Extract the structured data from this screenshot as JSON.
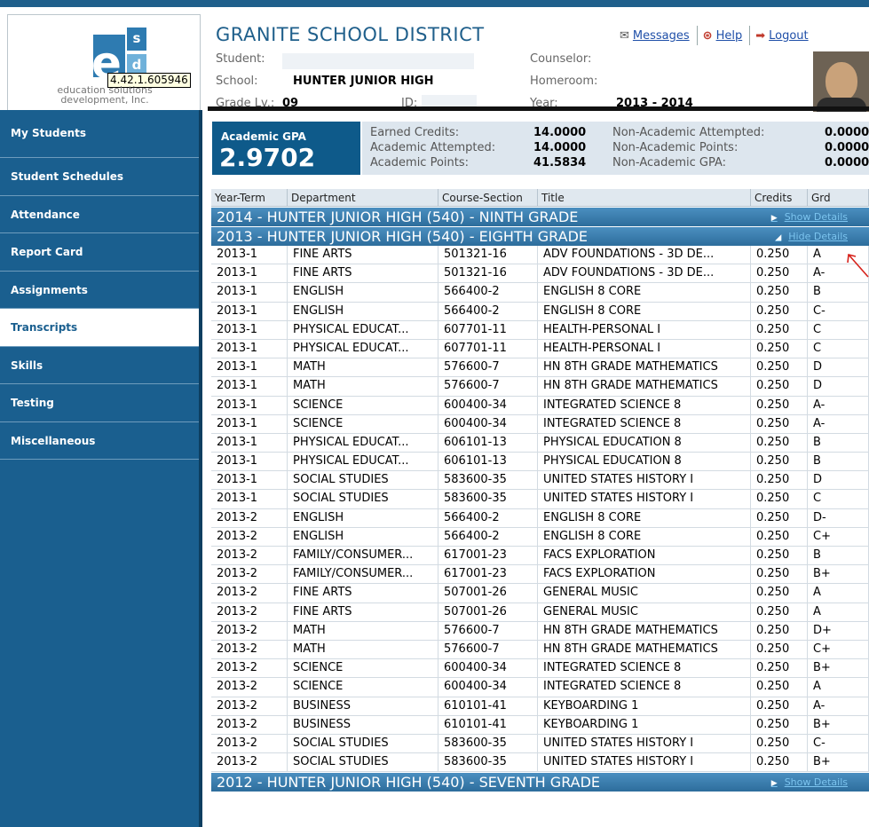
{
  "header": {
    "district": "GRANITE SCHOOL DISTRICT",
    "links": [
      {
        "label": "Messages",
        "icon": "envelope-icon"
      },
      {
        "label": "Help",
        "icon": "lifebuoy-icon"
      },
      {
        "label": "Logout",
        "icon": "logout-icon"
      }
    ],
    "logo_text_1": "education solutions",
    "logo_text_2": "development, Inc.",
    "logo_letters": {
      "e": "e",
      "s": "s",
      "d": "d"
    },
    "version": "4.42.1.605946",
    "labels": {
      "student": "Student:",
      "school": "School:",
      "grade": "Grade Lv.:",
      "id": "ID:",
      "counselor": "Counselor:",
      "homeroom": "Homeroom:",
      "year": "Year:"
    },
    "values": {
      "school": "HUNTER JUNIOR HIGH",
      "grade": "09",
      "year": "2013 - 2014"
    }
  },
  "sidebar": {
    "items": [
      {
        "label": "My Students",
        "active": false
      },
      {
        "label": "Student Schedules",
        "active": false
      },
      {
        "label": "Attendance",
        "active": false
      },
      {
        "label": "Report Card",
        "active": false
      },
      {
        "label": "Assignments",
        "active": false
      },
      {
        "label": "Transcripts",
        "active": true
      },
      {
        "label": "Skills",
        "active": false
      },
      {
        "label": "Testing",
        "active": false
      },
      {
        "label": "Miscellaneous",
        "active": false
      }
    ]
  },
  "gpa": {
    "label": "Academic GPA",
    "value": "2.9702",
    "earned_credits_label": "Earned Credits:",
    "earned_credits": "14.0000",
    "academic_attempted_label": "Academic Attempted:",
    "academic_attempted": "14.0000",
    "academic_points_label": "Academic Points:",
    "academic_points": "41.5834",
    "nonacademic_attempted_label": "Non-Academic Attempted:",
    "nonacademic_attempted": "0.0000",
    "nonacademic_points_label": "Non-Academic Points:",
    "nonacademic_points": "0.0000",
    "nonacademic_gpa_label": "Non-Academic GPA:",
    "nonacademic_gpa": "0.0000"
  },
  "transcript": {
    "columns": [
      "Year-Term",
      "Department",
      "Course-Section",
      "Title",
      "Credits",
      "Grd"
    ],
    "bands": {
      "y2014": {
        "title": "2014  -  HUNTER JUNIOR HIGH  (540)  - NINTH GRADE",
        "toggle": "Show Details"
      },
      "y2013": {
        "title": "2013  -  HUNTER JUNIOR HIGH  (540)  - EIGHTH GRADE",
        "toggle": "Hide Details"
      },
      "y2012": {
        "title": "2012  -  HUNTER JUNIOR HIGH  (540)  - SEVENTH GRADE",
        "toggle": "Show Details"
      }
    },
    "rows": [
      [
        "2013-1",
        "FINE ARTS",
        "501321-16",
        "ADV FOUNDATIONS - 3D DE...",
        "0.250",
        "A"
      ],
      [
        "2013-1",
        "FINE ARTS",
        "501321-16",
        "ADV FOUNDATIONS - 3D DE...",
        "0.250",
        "A-"
      ],
      [
        "2013-1",
        "ENGLISH",
        "566400-2",
        "ENGLISH 8 CORE",
        "0.250",
        "B"
      ],
      [
        "2013-1",
        "ENGLISH",
        "566400-2",
        "ENGLISH 8 CORE",
        "0.250",
        "C-"
      ],
      [
        "2013-1",
        "PHYSICAL EDUCAT...",
        "607701-11",
        "HEALTH-PERSONAL I",
        "0.250",
        "C"
      ],
      [
        "2013-1",
        "PHYSICAL EDUCAT...",
        "607701-11",
        "HEALTH-PERSONAL I",
        "0.250",
        "C"
      ],
      [
        "2013-1",
        "MATH",
        "576600-7",
        "HN 8TH GRADE MATHEMATICS",
        "0.250",
        "D"
      ],
      [
        "2013-1",
        "MATH",
        "576600-7",
        "HN 8TH GRADE MATHEMATICS",
        "0.250",
        "D"
      ],
      [
        "2013-1",
        "SCIENCE",
        "600400-34",
        "INTEGRATED SCIENCE 8",
        "0.250",
        "A-"
      ],
      [
        "2013-1",
        "SCIENCE",
        "600400-34",
        "INTEGRATED SCIENCE 8",
        "0.250",
        "A-"
      ],
      [
        "2013-1",
        "PHYSICAL EDUCAT...",
        "606101-13",
        "PHYSICAL EDUCATION 8",
        "0.250",
        "B"
      ],
      [
        "2013-1",
        "PHYSICAL EDUCAT...",
        "606101-13",
        "PHYSICAL EDUCATION 8",
        "0.250",
        "B"
      ],
      [
        "2013-1",
        "SOCIAL STUDIES",
        "583600-35",
        "UNITED STATES HISTORY I",
        "0.250",
        "D"
      ],
      [
        "2013-1",
        "SOCIAL STUDIES",
        "583600-35",
        "UNITED STATES HISTORY I",
        "0.250",
        "C"
      ],
      [
        "2013-2",
        "ENGLISH",
        "566400-2",
        "ENGLISH 8 CORE",
        "0.250",
        "D-"
      ],
      [
        "2013-2",
        "ENGLISH",
        "566400-2",
        "ENGLISH 8 CORE",
        "0.250",
        "C+"
      ],
      [
        "2013-2",
        "FAMILY/CONSUMER...",
        "617001-23",
        "FACS EXPLORATION",
        "0.250",
        "B"
      ],
      [
        "2013-2",
        "FAMILY/CONSUMER...",
        "617001-23",
        "FACS EXPLORATION",
        "0.250",
        "B+"
      ],
      [
        "2013-2",
        "FINE ARTS",
        "507001-26",
        "GENERAL MUSIC",
        "0.250",
        "A"
      ],
      [
        "2013-2",
        "FINE ARTS",
        "507001-26",
        "GENERAL MUSIC",
        "0.250",
        "A"
      ],
      [
        "2013-2",
        "MATH",
        "576600-7",
        "HN 8TH GRADE MATHEMATICS",
        "0.250",
        "D+"
      ],
      [
        "2013-2",
        "MATH",
        "576600-7",
        "HN 8TH GRADE MATHEMATICS",
        "0.250",
        "C+"
      ],
      [
        "2013-2",
        "SCIENCE",
        "600400-34",
        "INTEGRATED SCIENCE 8",
        "0.250",
        "B+"
      ],
      [
        "2013-2",
        "SCIENCE",
        "600400-34",
        "INTEGRATED SCIENCE 8",
        "0.250",
        "A"
      ],
      [
        "2013-2",
        "BUSINESS",
        "610101-41",
        "KEYBOARDING 1",
        "0.250",
        "A-"
      ],
      [
        "2013-2",
        "BUSINESS",
        "610101-41",
        "KEYBOARDING 1",
        "0.250",
        "B+"
      ],
      [
        "2013-2",
        "SOCIAL STUDIES",
        "583600-35",
        "UNITED STATES HISTORY I",
        "0.250",
        "C-"
      ],
      [
        "2013-2",
        "SOCIAL STUDIES",
        "583600-35",
        "UNITED STATES HISTORY I",
        "0.250",
        "B+"
      ]
    ]
  }
}
